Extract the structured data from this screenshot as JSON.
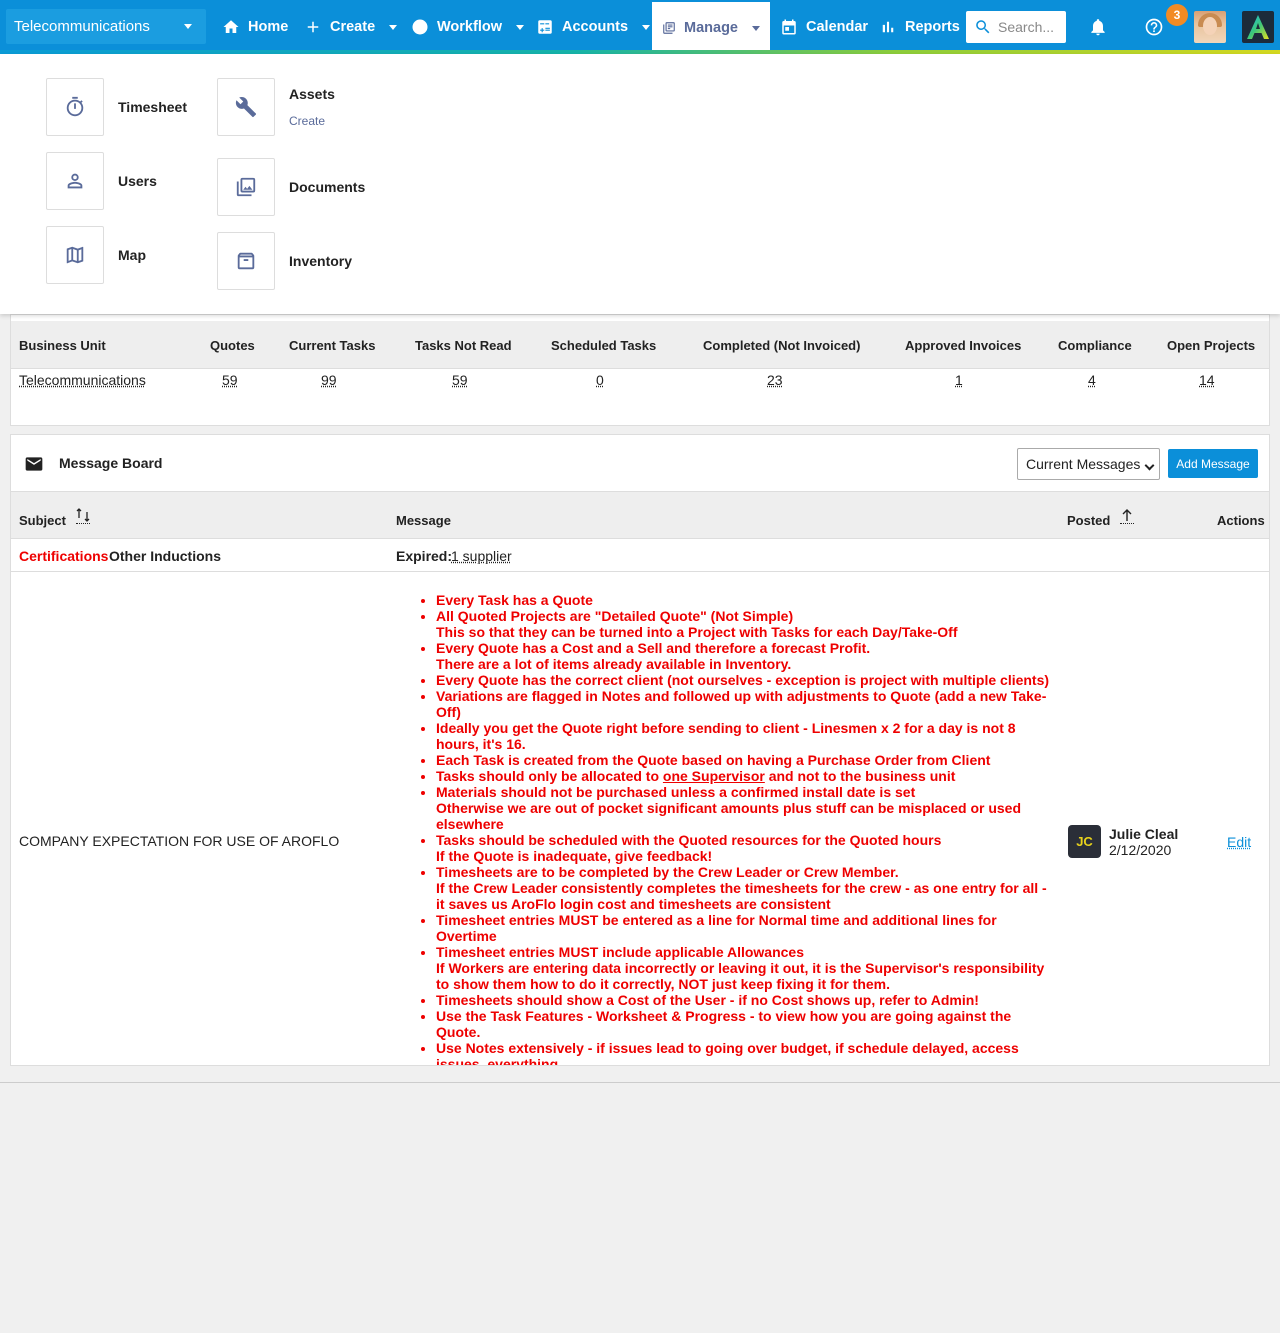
{
  "nav": {
    "business_unit": "Telecommunications",
    "items": [
      {
        "label": "Home",
        "icon": "home-icon"
      },
      {
        "label": "Create",
        "icon": "plus-icon"
      },
      {
        "label": "Workflow",
        "icon": "workflow-icon"
      },
      {
        "label": "Accounts",
        "icon": "calculator-icon"
      },
      {
        "label": "Manage",
        "icon": "manage-icon"
      },
      {
        "label": "Calendar",
        "icon": "calendar-icon"
      },
      {
        "label": "Reports",
        "icon": "bar-chart-icon"
      }
    ],
    "search_placeholder": "Search...",
    "help_badge": "3",
    "accent": "#0b8fd9"
  },
  "manage_menu": {
    "timesheet": "Timesheet",
    "users": "Users",
    "map": "Map",
    "assets": "Assets",
    "assets_sub": "Create",
    "documents": "Documents",
    "inventory": "Inventory"
  },
  "summary": {
    "headers": [
      "Business Unit",
      "Quotes",
      "Current Tasks",
      "Tasks Not Read",
      "Scheduled Tasks",
      "Completed (Not Invoiced)",
      "Approved Invoices",
      "Compliance",
      "Open Projects"
    ],
    "row": [
      "Telecommunications",
      "59",
      "99",
      "59",
      "0",
      "23",
      "1",
      "4",
      "14"
    ]
  },
  "message_board": {
    "title": "Message Board",
    "filter_selected": "Current Messages",
    "add_button": "Add Message",
    "headers": {
      "subject": "Subject",
      "message": "Message",
      "posted": "Posted",
      "actions": "Actions"
    },
    "cert_row": {
      "tag": "Certifications",
      "subject": "Other Inductions",
      "expired_label": "Expired:",
      "expired_value": "1 supplier"
    },
    "message": {
      "subject": "COMPANY EXPECTATION FOR USE OF AROFLO",
      "items": [
        "Every Task has a Quote",
        "All Quoted Projects are \"Detailed Quote\" (Not Simple)",
        "This so that they can be turned into a Project with Tasks for each Day/Take-Off",
        "Every Quote has a Cost and a Sell and therefore a forecast Profit.",
        "There are a lot of items already available in Inventory.",
        "Every Quote has the correct client (not ourselves - exception is project with multiple clients)",
        "Variations are flagged in Notes and followed up with adjustments to Quote (add a new Take-Off)",
        "Ideally you get the Quote right before sending to client - Linesmen x 2 for a day is not 8 hours, it's 16.",
        "Each Task is created from the Quote based on having a Purchase Order from Client",
        "Tasks should only be allocated to",
        "one Supervisor",
        "and not to the business unit",
        "Materials should not be purchased unless a confirmed install date is set",
        "Otherwise we are out of pocket significant amounts plus stuff can be misplaced or used elsewhere",
        "Tasks should be scheduled with the Quoted resources for the Quoted hours",
        "If the Quote is inadequate, give feedback!",
        "Timesheets are to be completed by the Crew Leader or Crew Member.",
        "If the Crew Leader consistently completes the timesheets for the crew - as one entry for all - it saves us AroFlo login cost and timesheets are consistent",
        "Timesheet entries MUST be entered as a line for Normal time and additional lines for Overtime",
        "Timesheet entries MUST include applicable Allowances",
        "If Workers are entering data incorrectly or leaving it out, it is the Supervisor's responsibility to show them how to do it correctly, NOT just keep fixing it for them.",
        "Timesheets should show a Cost of the User - if no Cost shows up, refer to Admin!",
        "Use the Task Features - Worksheet & Progress - to view how you are going against the Quote.",
        "Use Notes extensively - if issues lead to going over budget, if schedule delayed, access issues, everything"
      ],
      "poster_initials": "JC",
      "poster_name": "Julie Cleal",
      "posted_date": "2/12/2020",
      "edit_label": "Edit"
    }
  }
}
